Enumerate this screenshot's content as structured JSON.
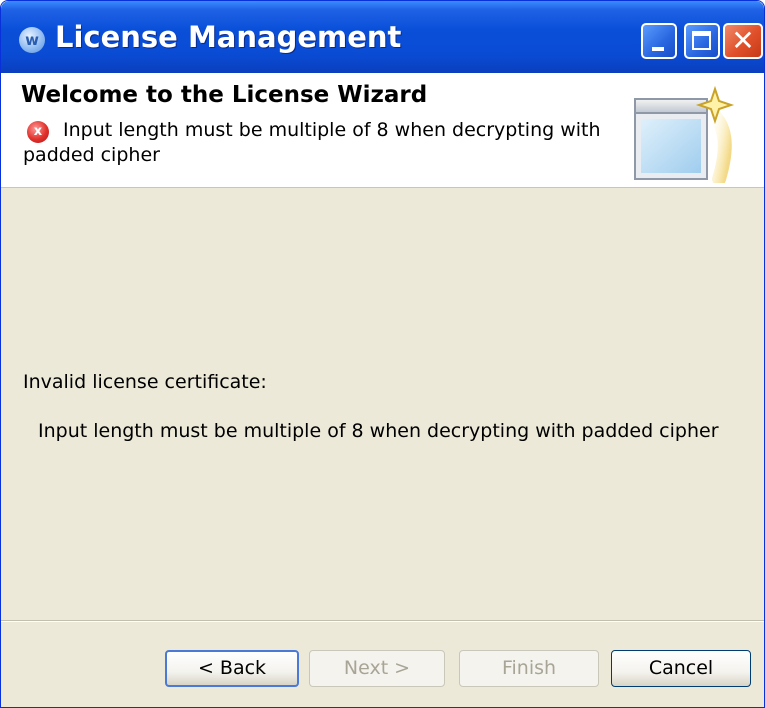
{
  "window": {
    "title": "License Management",
    "app_icon": "eclipse-w-icon"
  },
  "header": {
    "title": "Welcome to the License Wizard",
    "error_message_line1": "Input length must be multiple of 8 when decrypting with",
    "error_message_line2": "padded cipher",
    "error_icon_glyph": "x"
  },
  "content": {
    "label": "Invalid license certificate:",
    "message": "Input length must be multiple of 8 when decrypting with padded cipher"
  },
  "buttons": {
    "back": "< Back",
    "next": "Next >",
    "finish": "Finish",
    "cancel": "Cancel"
  },
  "colors": {
    "titlebar": "#0a4fd8",
    "dialog_bg": "#ece9d8",
    "error": "#e0302a"
  }
}
